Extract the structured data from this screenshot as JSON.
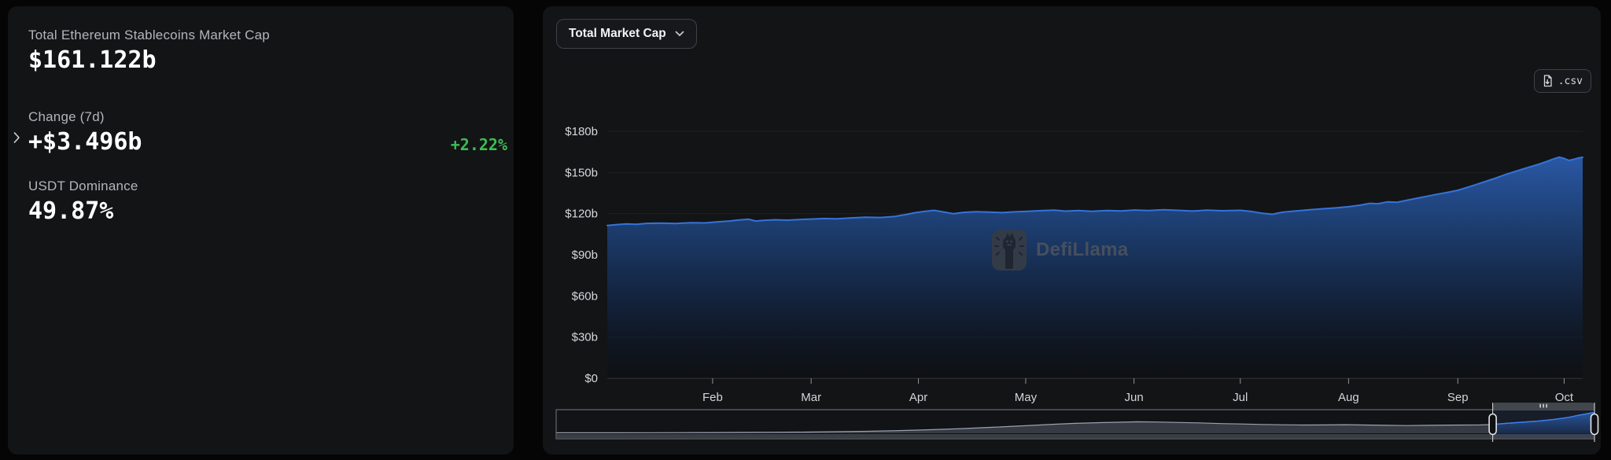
{
  "page": {
    "background": "#050506"
  },
  "colors": {
    "card_bg": "#131416",
    "border": "#3e4147",
    "accent_line": "#3573d9",
    "area_top": "#2e62b8",
    "positive_green": "#3dbd54",
    "label_gray": "#b2b5ba",
    "axis_text": "#d6d8db",
    "watermark_gray": "#4a5160",
    "brush_gray_fill": "#3a3f48",
    "brush_gray_line": "#9aa2af",
    "brush_blue_line": "#3b82f6"
  },
  "stats_panel": {
    "metrics": [
      {
        "label": "Total Ethereum Stablecoins Market Cap",
        "value": "$161.122b"
      },
      {
        "label": "Change (7d)",
        "value": "+$3.496b",
        "change_pct": "+2.22%"
      },
      {
        "label": "USDT Dominance",
        "value": "49.87%"
      }
    ]
  },
  "chart_panel": {
    "metric_selector_label": "Total Market Cap",
    "csv_button_label": ".csv",
    "watermark_text": "DefiLlama"
  },
  "chart_data": [
    {
      "type": "area",
      "title": "Total Market Cap",
      "xlabel": "",
      "ylabel": "",
      "unit": "USD billions",
      "ylim": [
        0,
        180
      ],
      "grid": true,
      "legend_position": "none",
      "y_ticks": [
        0,
        30,
        60,
        90,
        120,
        150,
        180
      ],
      "y_tick_labels": [
        "$0",
        "$30b",
        "$60b",
        "$90b",
        "$120b",
        "$150b",
        "$180b"
      ],
      "x_tick_labels": [
        "Feb",
        "Mar",
        "Apr",
        "May",
        "Jun",
        "Jul",
        "Aug",
        "Sep",
        "Oct"
      ],
      "x_tick_pos": [
        0.108,
        0.209,
        0.319,
        0.429,
        0.54,
        0.649,
        0.76,
        0.872,
        0.981
      ],
      "series": [
        {
          "name": "Total Ethereum Stablecoins Market Cap ($b)",
          "points": [
            [
              0,
              111.3
            ],
            [
              0.01,
              112
            ],
            [
              0.02,
              112.5
            ],
            [
              0.03,
              112.2
            ],
            [
              0.04,
              112.9
            ],
            [
              0.055,
              113.1
            ],
            [
              0.07,
              112.8
            ],
            [
              0.085,
              113.4
            ],
            [
              0.1,
              113.2
            ],
            [
              0.112,
              113.9
            ],
            [
              0.125,
              114.6
            ],
            [
              0.135,
              115.4
            ],
            [
              0.145,
              115.9
            ],
            [
              0.152,
              114.6
            ],
            [
              0.16,
              115.1
            ],
            [
              0.172,
              115.5
            ],
            [
              0.185,
              115.2
            ],
            [
              0.2,
              115.8
            ],
            [
              0.209,
              116
            ],
            [
              0.222,
              116.4
            ],
            [
              0.235,
              116.2
            ],
            [
              0.25,
              116.9
            ],
            [
              0.265,
              117.4
            ],
            [
              0.28,
              117.2
            ],
            [
              0.295,
              118
            ],
            [
              0.305,
              119.2
            ],
            [
              0.315,
              120.6
            ],
            [
              0.325,
              121.6
            ],
            [
              0.335,
              122.4
            ],
            [
              0.345,
              121.2
            ],
            [
              0.355,
              119.9
            ],
            [
              0.365,
              120.9
            ],
            [
              0.378,
              121.4
            ],
            [
              0.392,
              121.1
            ],
            [
              0.405,
              120.7
            ],
            [
              0.418,
              121.3
            ],
            [
              0.429,
              121.6
            ],
            [
              0.443,
              122.1
            ],
            [
              0.458,
              122.5
            ],
            [
              0.47,
              121.8
            ],
            [
              0.483,
              122.2
            ],
            [
              0.497,
              121.7
            ],
            [
              0.512,
              122.3
            ],
            [
              0.527,
              122
            ],
            [
              0.54,
              122.6
            ],
            [
              0.555,
              122.2
            ],
            [
              0.57,
              122.8
            ],
            [
              0.585,
              122.4
            ],
            [
              0.6,
              121.9
            ],
            [
              0.615,
              122.5
            ],
            [
              0.63,
              122.1
            ],
            [
              0.649,
              122.4
            ],
            [
              0.66,
              121.6
            ],
            [
              0.672,
              120.2
            ],
            [
              0.682,
              119.5
            ],
            [
              0.692,
              121
            ],
            [
              0.705,
              121.9
            ],
            [
              0.72,
              122.8
            ],
            [
              0.735,
              123.6
            ],
            [
              0.748,
              124.3
            ],
            [
              0.76,
              125
            ],
            [
              0.772,
              126.2
            ],
            [
              0.782,
              127.5
            ],
            [
              0.79,
              127.2
            ],
            [
              0.8,
              128.6
            ],
            [
              0.81,
              128.3
            ],
            [
              0.82,
              129.8
            ],
            [
              0.83,
              131.2
            ],
            [
              0.84,
              132.6
            ],
            [
              0.85,
              134
            ],
            [
              0.86,
              135.3
            ],
            [
              0.872,
              137
            ],
            [
              0.882,
              139.2
            ],
            [
              0.892,
              141.5
            ],
            [
              0.902,
              143.8
            ],
            [
              0.912,
              146.2
            ],
            [
              0.922,
              148.8
            ],
            [
              0.932,
              151
            ],
            [
              0.94,
              152.8
            ],
            [
              0.948,
              154.5
            ],
            [
              0.956,
              156.2
            ],
            [
              0.963,
              158
            ],
            [
              0.97,
              159.8
            ],
            [
              0.976,
              161.2
            ],
            [
              0.981,
              160.2
            ],
            [
              0.986,
              158.8
            ],
            [
              0.991,
              159.6
            ],
            [
              0.996,
              160.6
            ],
            [
              1,
              161.1
            ]
          ]
        }
      ]
    },
    {
      "type": "area",
      "role": "brush-minimap",
      "title": "Full history minimap (normalized height 0-1)",
      "selection": [
        0.902,
        1.0
      ],
      "points": [
        [
          0,
          0.02
        ],
        [
          0.03,
          0.02
        ],
        [
          0.06,
          0.022
        ],
        [
          0.09,
          0.025
        ],
        [
          0.12,
          0.03
        ],
        [
          0.15,
          0.033
        ],
        [
          0.18,
          0.038
        ],
        [
          0.21,
          0.045
        ],
        [
          0.24,
          0.055
        ],
        [
          0.27,
          0.07
        ],
        [
          0.3,
          0.09
        ],
        [
          0.33,
          0.12
        ],
        [
          0.36,
          0.16
        ],
        [
          0.39,
          0.21
        ],
        [
          0.42,
          0.27
        ],
        [
          0.45,
          0.34
        ],
        [
          0.48,
          0.41
        ],
        [
          0.5,
          0.45
        ],
        [
          0.52,
          0.48
        ],
        [
          0.54,
          0.5
        ],
        [
          0.56,
          0.52
        ],
        [
          0.58,
          0.51
        ],
        [
          0.6,
          0.49
        ],
        [
          0.62,
          0.47
        ],
        [
          0.64,
          0.44
        ],
        [
          0.66,
          0.42
        ],
        [
          0.68,
          0.4
        ],
        [
          0.7,
          0.385
        ],
        [
          0.72,
          0.375
        ],
        [
          0.74,
          0.38
        ],
        [
          0.76,
          0.39
        ],
        [
          0.78,
          0.375
        ],
        [
          0.8,
          0.36
        ],
        [
          0.82,
          0.35
        ],
        [
          0.84,
          0.36
        ],
        [
          0.86,
          0.37
        ],
        [
          0.875,
          0.375
        ],
        [
          0.89,
          0.38
        ],
        [
          0.902,
          0.4
        ],
        [
          0.915,
          0.45
        ],
        [
          0.93,
          0.5
        ],
        [
          0.945,
          0.55
        ],
        [
          0.96,
          0.62
        ],
        [
          0.975,
          0.72
        ],
        [
          0.985,
          0.82
        ],
        [
          1,
          0.95
        ]
      ]
    }
  ]
}
